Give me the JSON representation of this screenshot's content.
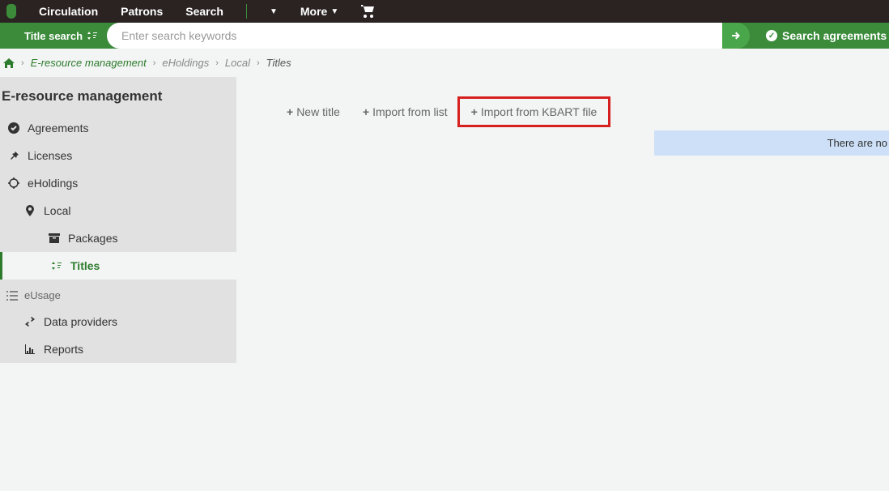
{
  "topnav": {
    "items": [
      "Circulation",
      "Patrons",
      "Search"
    ],
    "more": "More"
  },
  "search": {
    "label": "Title search",
    "placeholder": "Enter search keywords",
    "right_link": "Search agreements"
  },
  "breadcrumb": {
    "items": [
      "E-resource management",
      "eHoldings",
      "Local",
      "Titles"
    ]
  },
  "sidebar": {
    "title": "E-resource management",
    "agreements": "Agreements",
    "licenses": "Licenses",
    "eholdings": "eHoldings",
    "local": "Local",
    "packages": "Packages",
    "titles": "Titles",
    "eusage": "eUsage",
    "data_providers": "Data providers",
    "reports": "Reports"
  },
  "toolbar": {
    "new_title": "New title",
    "import_list": "Import from list",
    "import_kbart": "Import from KBART file"
  },
  "info": {
    "message": "There are no"
  }
}
